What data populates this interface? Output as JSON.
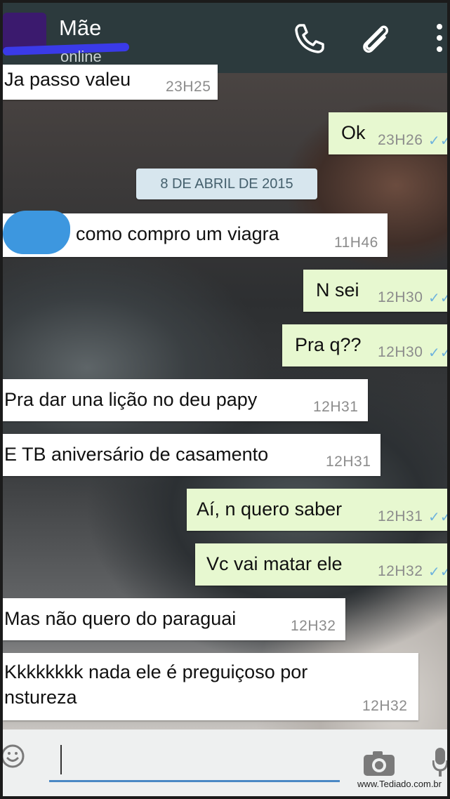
{
  "header": {
    "contact_name": "Mãe",
    "contact_status": "online"
  },
  "date_divider": "8 DE ABRIL DE 2015",
  "messages": [
    {
      "direction": "in",
      "text": "Ja passo valeu",
      "time": "23H25"
    },
    {
      "direction": "out",
      "text": "Ok",
      "time": "23H26"
    },
    {
      "direction": "in",
      "text": "como compro um viagra",
      "time": "11H46"
    },
    {
      "direction": "out",
      "text": "N sei",
      "time": "12H30"
    },
    {
      "direction": "out",
      "text": "Pra q??",
      "time": "12H30"
    },
    {
      "direction": "in",
      "text": "Pra dar una lição no deu papy",
      "time": "12H31"
    },
    {
      "direction": "in",
      "text": "E TB aniversário de casamento",
      "time": "12H31"
    },
    {
      "direction": "out",
      "text": "Aí, n quero saber",
      "time": "12H31"
    },
    {
      "direction": "out",
      "text": "Vc vai matar ele",
      "time": "12H32"
    },
    {
      "direction": "in",
      "text": "Mas não quero do paraguai",
      "time": "12H32"
    },
    {
      "direction": "in",
      "text": "Kkkkkkkk nada ele é preguiçoso por",
      "text2": "nstureza",
      "time": "12H32"
    }
  ],
  "read_ticks": "✓✓",
  "watermark": "www.Tediado.com.br",
  "icons": {
    "call": "phone-icon",
    "attach": "paperclip-icon",
    "menu": "overflow-menu-icon",
    "emoji": "emoji-icon",
    "camera": "camera-icon",
    "mic": "mic-icon"
  },
  "colors": {
    "header_bg": "#2c3a3d",
    "outgoing_bubble": "#e7f8d0",
    "incoming_bubble": "#ffffff",
    "tick_blue": "#6fb3dd",
    "date_chip": "#d7e6ee"
  }
}
